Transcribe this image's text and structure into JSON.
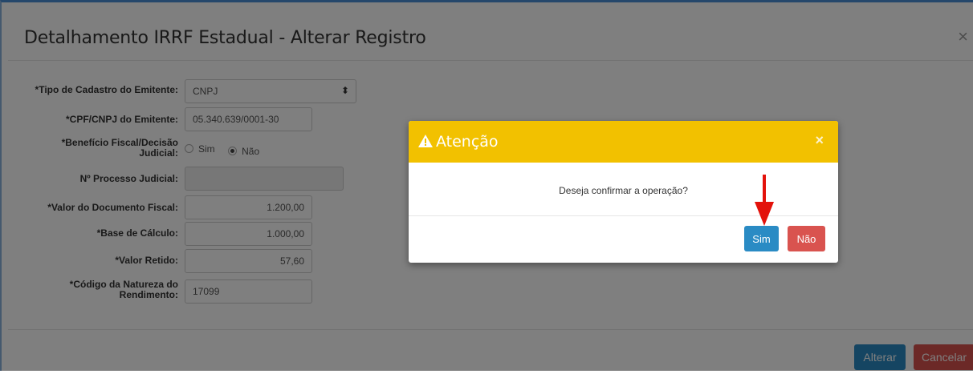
{
  "modal": {
    "title": "Detalhamento IRRF Estadual - Alterar Registro",
    "close_glyph": "×"
  },
  "form": {
    "tipo_cadastro": {
      "label": "*Tipo de Cadastro do Emitente:",
      "value": "CNPJ"
    },
    "cpf_cnpj": {
      "label": "*CPF/CNPJ do Emitente:",
      "value": "05.340.639/0001-30"
    },
    "beneficio": {
      "label_line1": "*Benefício Fiscal/Decisão",
      "label_line2": "Judicial:",
      "options": [
        {
          "label": "Sim",
          "selected": false
        },
        {
          "label": "Não",
          "selected": true
        }
      ]
    },
    "processo": {
      "label": "Nº Processo Judicial:",
      "value": ""
    },
    "valor_documento": {
      "label": "*Valor do Documento Fiscal:",
      "value": "1.200,00"
    },
    "base_calculo": {
      "label": "*Base de Cálculo:",
      "value": "1.000,00"
    },
    "valor_retido": {
      "label": "*Valor Retido:",
      "value": "57,60"
    },
    "codigo_natureza": {
      "label_line1": "*Código da Natureza do",
      "label_line2": "Rendimento:",
      "value": "17099"
    }
  },
  "footer": {
    "alterar_label": "Alterar",
    "cancelar_label": "Cancelar"
  },
  "dialog": {
    "title": "Atenção",
    "close_glyph": "×",
    "message": "Deseja confirmar a operação?",
    "sim_label": "Sim",
    "nao_label": "Não"
  },
  "colors": {
    "warning_header": "#f2c100",
    "primary": "#2a8bc4",
    "danger": "#d9534f",
    "annotation_arrow": "#e3120b"
  }
}
